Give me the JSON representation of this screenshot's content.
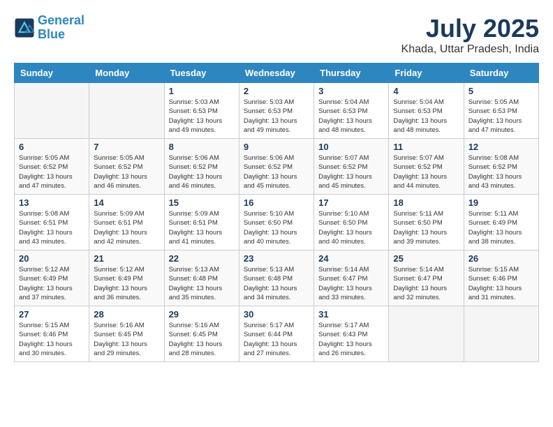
{
  "logo": {
    "line1": "General",
    "line2": "Blue"
  },
  "title": "July 2025",
  "location": "Khada, Uttar Pradesh, India",
  "weekdays": [
    "Sunday",
    "Monday",
    "Tuesday",
    "Wednesday",
    "Thursday",
    "Friday",
    "Saturday"
  ],
  "weeks": [
    [
      {
        "day": "",
        "info": ""
      },
      {
        "day": "",
        "info": ""
      },
      {
        "day": "1",
        "info": "Sunrise: 5:03 AM\nSunset: 6:53 PM\nDaylight: 13 hours\nand 49 minutes."
      },
      {
        "day": "2",
        "info": "Sunrise: 5:03 AM\nSunset: 6:53 PM\nDaylight: 13 hours\nand 49 minutes."
      },
      {
        "day": "3",
        "info": "Sunrise: 5:04 AM\nSunset: 6:53 PM\nDaylight: 13 hours\nand 48 minutes."
      },
      {
        "day": "4",
        "info": "Sunrise: 5:04 AM\nSunset: 6:53 PM\nDaylight: 13 hours\nand 48 minutes."
      },
      {
        "day": "5",
        "info": "Sunrise: 5:05 AM\nSunset: 6:53 PM\nDaylight: 13 hours\nand 47 minutes."
      }
    ],
    [
      {
        "day": "6",
        "info": "Sunrise: 5:05 AM\nSunset: 6:52 PM\nDaylight: 13 hours\nand 47 minutes."
      },
      {
        "day": "7",
        "info": "Sunrise: 5:05 AM\nSunset: 6:52 PM\nDaylight: 13 hours\nand 46 minutes."
      },
      {
        "day": "8",
        "info": "Sunrise: 5:06 AM\nSunset: 6:52 PM\nDaylight: 13 hours\nand 46 minutes."
      },
      {
        "day": "9",
        "info": "Sunrise: 5:06 AM\nSunset: 6:52 PM\nDaylight: 13 hours\nand 45 minutes."
      },
      {
        "day": "10",
        "info": "Sunrise: 5:07 AM\nSunset: 6:52 PM\nDaylight: 13 hours\nand 45 minutes."
      },
      {
        "day": "11",
        "info": "Sunrise: 5:07 AM\nSunset: 6:52 PM\nDaylight: 13 hours\nand 44 minutes."
      },
      {
        "day": "12",
        "info": "Sunrise: 5:08 AM\nSunset: 6:52 PM\nDaylight: 13 hours\nand 43 minutes."
      }
    ],
    [
      {
        "day": "13",
        "info": "Sunrise: 5:08 AM\nSunset: 6:51 PM\nDaylight: 13 hours\nand 43 minutes."
      },
      {
        "day": "14",
        "info": "Sunrise: 5:09 AM\nSunset: 6:51 PM\nDaylight: 13 hours\nand 42 minutes."
      },
      {
        "day": "15",
        "info": "Sunrise: 5:09 AM\nSunset: 6:51 PM\nDaylight: 13 hours\nand 41 minutes."
      },
      {
        "day": "16",
        "info": "Sunrise: 5:10 AM\nSunset: 6:50 PM\nDaylight: 13 hours\nand 40 minutes."
      },
      {
        "day": "17",
        "info": "Sunrise: 5:10 AM\nSunset: 6:50 PM\nDaylight: 13 hours\nand 40 minutes."
      },
      {
        "day": "18",
        "info": "Sunrise: 5:11 AM\nSunset: 6:50 PM\nDaylight: 13 hours\nand 39 minutes."
      },
      {
        "day": "19",
        "info": "Sunrise: 5:11 AM\nSunset: 6:49 PM\nDaylight: 13 hours\nand 38 minutes."
      }
    ],
    [
      {
        "day": "20",
        "info": "Sunrise: 5:12 AM\nSunset: 6:49 PM\nDaylight: 13 hours\nand 37 minutes."
      },
      {
        "day": "21",
        "info": "Sunrise: 5:12 AM\nSunset: 6:49 PM\nDaylight: 13 hours\nand 36 minutes."
      },
      {
        "day": "22",
        "info": "Sunrise: 5:13 AM\nSunset: 6:48 PM\nDaylight: 13 hours\nand 35 minutes."
      },
      {
        "day": "23",
        "info": "Sunrise: 5:13 AM\nSunset: 6:48 PM\nDaylight: 13 hours\nand 34 minutes."
      },
      {
        "day": "24",
        "info": "Sunrise: 5:14 AM\nSunset: 6:47 PM\nDaylight: 13 hours\nand 33 minutes."
      },
      {
        "day": "25",
        "info": "Sunrise: 5:14 AM\nSunset: 6:47 PM\nDaylight: 13 hours\nand 32 minutes."
      },
      {
        "day": "26",
        "info": "Sunrise: 5:15 AM\nSunset: 6:46 PM\nDaylight: 13 hours\nand 31 minutes."
      }
    ],
    [
      {
        "day": "27",
        "info": "Sunrise: 5:15 AM\nSunset: 6:46 PM\nDaylight: 13 hours\nand 30 minutes."
      },
      {
        "day": "28",
        "info": "Sunrise: 5:16 AM\nSunset: 6:45 PM\nDaylight: 13 hours\nand 29 minutes."
      },
      {
        "day": "29",
        "info": "Sunrise: 5:16 AM\nSunset: 6:45 PM\nDaylight: 13 hours\nand 28 minutes."
      },
      {
        "day": "30",
        "info": "Sunrise: 5:17 AM\nSunset: 6:44 PM\nDaylight: 13 hours\nand 27 minutes."
      },
      {
        "day": "31",
        "info": "Sunrise: 5:17 AM\nSunset: 6:43 PM\nDaylight: 13 hours\nand 26 minutes."
      },
      {
        "day": "",
        "info": ""
      },
      {
        "day": "",
        "info": ""
      }
    ]
  ]
}
